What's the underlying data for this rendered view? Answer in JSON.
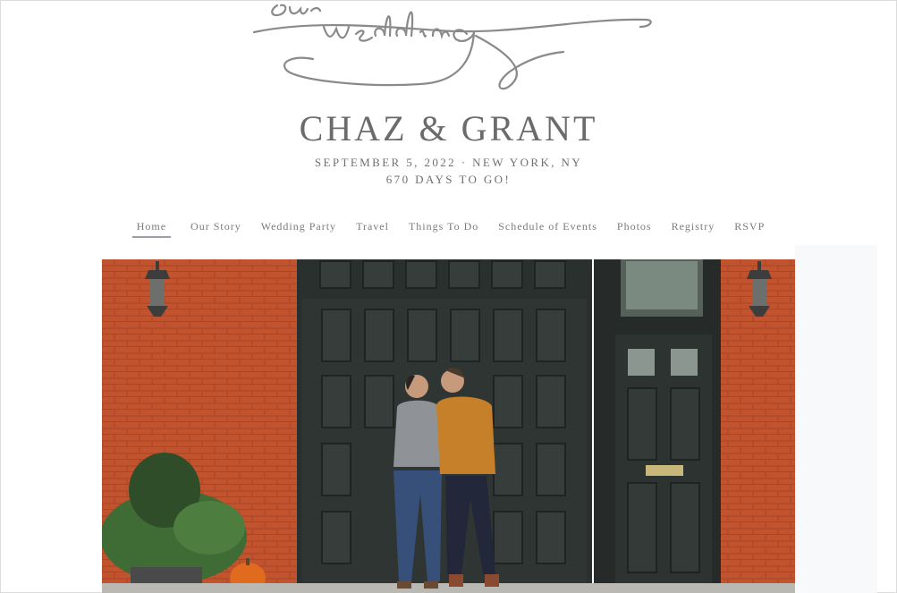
{
  "header": {
    "script_title": "our wedding",
    "couple_names": "CHAZ & GRANT",
    "date_location": "SEPTEMBER 5, 2022 · NEW YORK, NY",
    "countdown": "670 DAYS TO GO!"
  },
  "nav": {
    "active": "Home",
    "items": [
      {
        "label": "Home"
      },
      {
        "label": "Our Story"
      },
      {
        "label": "Wedding Party"
      },
      {
        "label": "Travel"
      },
      {
        "label": "Things To Do"
      },
      {
        "label": "Schedule of Events"
      },
      {
        "label": "Photos"
      },
      {
        "label": "Registry"
      },
      {
        "label": "RSVP"
      }
    ]
  },
  "colors": {
    "brick": "#c1532f",
    "door": "#2c3330",
    "text": "#6b6b6b"
  }
}
